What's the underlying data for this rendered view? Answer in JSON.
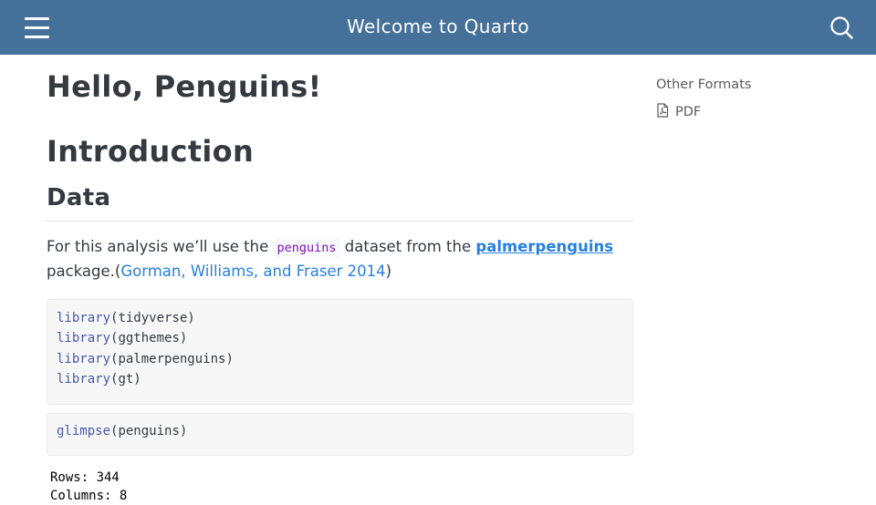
{
  "navbar": {
    "title": "Welcome to Quarto",
    "icons": [
      "hamburger-menu-icon",
      "search-icon"
    ],
    "background": "#447099"
  },
  "page": {
    "title": "Hello, Penguins!",
    "h1_introduction": "Introduction",
    "h2_data": "Data",
    "paragraph": {
      "before_code": "For this analysis we’ll use the ",
      "inline_code": "penguins",
      "mid": " dataset from the ",
      "pkg_link": "palmerpenguins",
      "after_link": " package.(",
      "citation": "Gorman, Williams, and Fraser 2014",
      "end": ")"
    }
  },
  "code_blocks": [
    {
      "lines": [
        {
          "fn": "library",
          "args": "(tidyverse)"
        },
        {
          "fn": "library",
          "args": "(ggthemes)"
        },
        {
          "fn": "library",
          "args": "(palmerpenguins)"
        },
        {
          "fn": "library",
          "args": "(gt)"
        }
      ]
    },
    {
      "lines": [
        {
          "fn": "glimpse",
          "args": "(penguins)"
        }
      ]
    }
  ],
  "output": {
    "line1": "Rows: 344",
    "line2": "Columns: 8"
  },
  "sidebar": {
    "heading": "Other Formats",
    "formats": [
      {
        "label": "PDF",
        "icon": "pdf-file-icon"
      }
    ]
  },
  "colors": {
    "link": "#2780e3",
    "code_fn": "#4758ab",
    "inline_code": "#7d12ba"
  }
}
